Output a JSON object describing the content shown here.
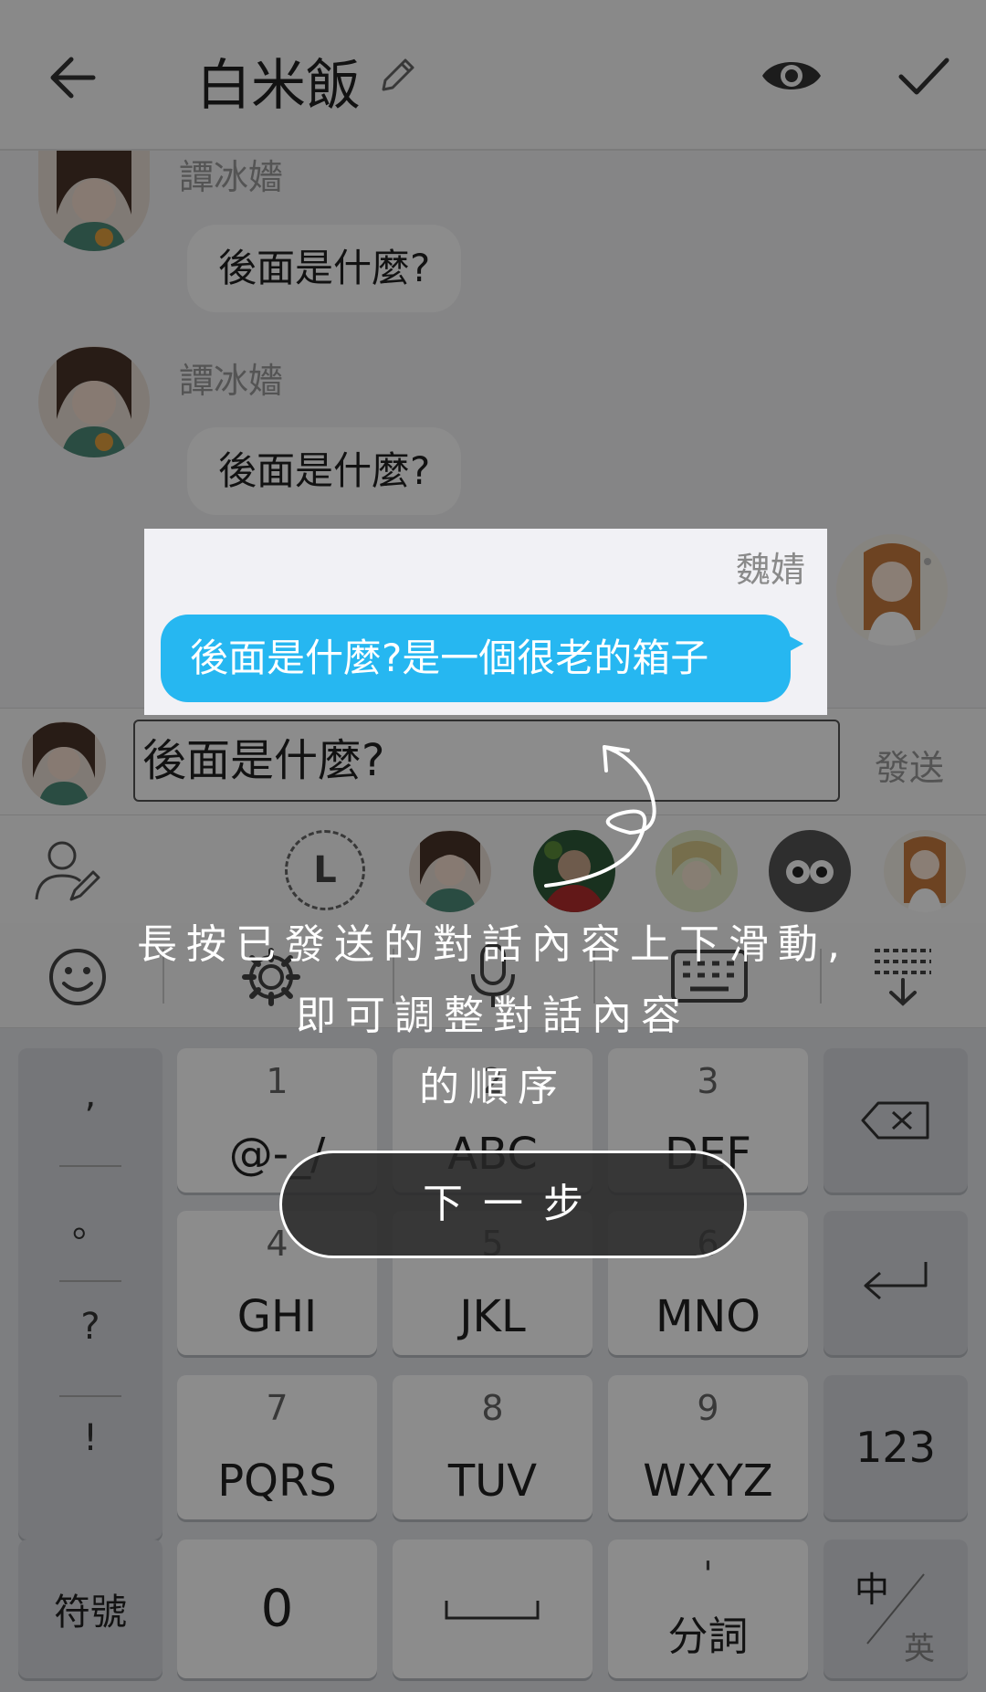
{
  "header": {
    "title": "白米飯"
  },
  "messages": [
    {
      "sender": "譚冰嬙",
      "text": "後面是什麼?"
    },
    {
      "sender": "譚冰嬙",
      "text": "後面是什麼?"
    }
  ],
  "highlighted_message": {
    "sender": "魏婧",
    "text": "後面是什麼?是一個很老的箱子"
  },
  "input": {
    "value": "後面是什麼?",
    "send_label": "發送"
  },
  "avatar_strip": {
    "letter_badge": "L"
  },
  "keyboard": {
    "punctuation": [
      ",",
      "。",
      "?",
      "!"
    ],
    "keys": [
      {
        "num": "1",
        "letters": "@-_/"
      },
      {
        "num": "2",
        "letters": "ABC"
      },
      {
        "num": "3",
        "letters": "DEF"
      },
      {
        "num": "4",
        "letters": "GHI"
      },
      {
        "num": "5",
        "letters": "JKL"
      },
      {
        "num": "6",
        "letters": "MNO"
      },
      {
        "num": "7",
        "letters": "PQRS"
      },
      {
        "num": "8",
        "letters": "TUV"
      },
      {
        "num": "9",
        "letters": "WXYZ"
      }
    ],
    "num_toggle": "123",
    "symbols": "符號",
    "zero": "0",
    "segment_mark": "'",
    "segment": "分詞",
    "lang_top": "中",
    "lang_bottom": "英"
  },
  "tutorial": {
    "line1": "長按已發送的對話內容上下滑動,",
    "line2": "即可調整對話內容",
    "line3": "的順序",
    "next_label": "下一步"
  },
  "colors": {
    "accent": "#26b7f1",
    "overlay": "rgba(0,0,0,0.45)"
  }
}
